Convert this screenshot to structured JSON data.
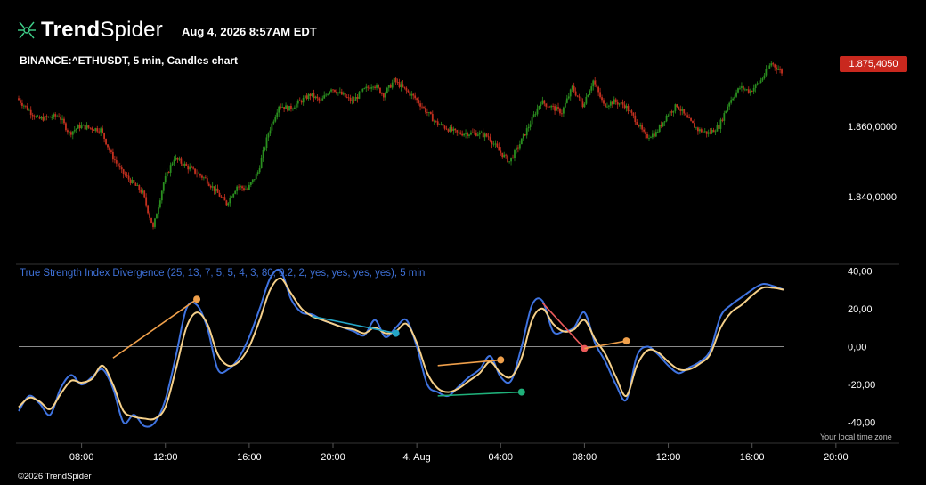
{
  "header": {
    "brand_bold": "Trend",
    "brand_light": "Spider",
    "timestamp": "Aug 4, 2026 8:57AM EDT",
    "symbol_line": "BINANCE:^ETHUSDT, 5 min, Candles chart",
    "current_price": "1.875,4050"
  },
  "indicator": {
    "label": "True Strength Index Divergence (25, 13, 7, 5, 5, 4, 3, 80, 0.2, 2, yes, yes, yes, yes), 5 min"
  },
  "footer": {
    "timezone_note": "Your local time zone",
    "copyright": "©2026 TrendSpider"
  },
  "colors": {
    "up": "#2a8f1f",
    "down": "#c4301f",
    "tsi": "#3f73e0",
    "signal": "#f5d08a",
    "bull_div": "#1fb07a",
    "bear_div": "#f0a04b",
    "hidden_bear": "#ec5b5b",
    "hidden_bull": "#23a6c7",
    "badge": "#c9281e"
  },
  "chart_data": [
    {
      "type": "line",
      "title": "BINANCE:^ETHUSDT, 5 min, Candles chart",
      "style": "candles",
      "y_ticks": [
        {
          "value": 1860,
          "label": "1.860,0000"
        },
        {
          "value": 1840,
          "label": "1.840,0000"
        }
      ],
      "ylim": [
        1822,
        1882
      ],
      "x_ticks": [
        "08:00",
        "12:00",
        "16:00",
        "20:00",
        "4. Aug",
        "04:00",
        "08:00",
        "12:00",
        "16:00",
        "20:00"
      ],
      "xlim_hours": [
        5.0,
        25.0
      ],
      "series": [
        {
          "x_hours": [
            5.0,
            6.0,
            7.0,
            7.5,
            8.0,
            9.0,
            9.5,
            10.0,
            11.0,
            11.5,
            12.0,
            12.5,
            13.0,
            14.0,
            15.0,
            15.5,
            16.0,
            16.5,
            17.0,
            17.5,
            18.0,
            19.0,
            19.5,
            20.0,
            21.0,
            21.5,
            22.0,
            22.5,
            23.0,
            24.0,
            25.0,
            26.0,
            27.0,
            27.5,
            28.0,
            28.5,
            29.0,
            30.0,
            31.0,
            31.5,
            32.0,
            32.5,
            33.0,
            33.5,
            34.0,
            34.5,
            35.0,
            35.5,
            36.0,
            36.5,
            37.0,
            37.5,
            38.0,
            38.5,
            39.0,
            39.5,
            40.0,
            40.5,
            41.0,
            41.5
          ],
          "values": [
            1868,
            1862,
            1863,
            1858,
            1860,
            1859,
            1852,
            1847,
            1841,
            1831,
            1844,
            1851,
            1849,
            1845,
            1838,
            1843,
            1842,
            1847,
            1858,
            1866,
            1865,
            1869,
            1867,
            1871,
            1867,
            1870,
            1872,
            1869,
            1873,
            1868,
            1861,
            1858,
            1858,
            1857,
            1853,
            1850,
            1855,
            1867,
            1864,
            1871,
            1866,
            1873,
            1866,
            1867,
            1866,
            1862,
            1857,
            1858,
            1863,
            1866,
            1862,
            1859,
            1858,
            1860,
            1867,
            1871,
            1870,
            1873,
            1878,
            1875.4
          ]
        }
      ]
    },
    {
      "type": "line",
      "title": "True Strength Index Divergence (25, 13, 7, 5, 5, 4, 3, 80, 0.2, 2, yes, yes, yes, yes), 5 min",
      "y_ticks": [
        {
          "value": 40,
          "label": "40,00"
        },
        {
          "value": 20,
          "label": "20,00"
        },
        {
          "value": 0,
          "label": "0,00"
        },
        {
          "value": -20,
          "label": "-20,00"
        },
        {
          "value": -40,
          "label": "-40,00"
        }
      ],
      "ylim": [
        -50,
        42
      ],
      "series": [
        {
          "x_hours": [
            5.0,
            5.5,
            6.0,
            6.5,
            7.0,
            7.5,
            8.0,
            8.5,
            9.0,
            9.5,
            10.0,
            10.5,
            11.0,
            11.5,
            12.0,
            12.5,
            13.0,
            13.5,
            14.0,
            14.5,
            15.0,
            15.5,
            16.0,
            16.5,
            17.0,
            17.5,
            18.0,
            18.5,
            19.0,
            19.5,
            20.0,
            20.5,
            21.0,
            21.5,
            22.0,
            22.5,
            23.0,
            23.5,
            24.0,
            24.5,
            25.0,
            25.5,
            26.0,
            26.5,
            27.0,
            27.5,
            28.0,
            28.5,
            29.0,
            29.5,
            30.0,
            30.5,
            31.0,
            31.5,
            32.0,
            32.5,
            33.0,
            33.5,
            34.0,
            34.5,
            35.0,
            35.5,
            36.0,
            36.5,
            37.0,
            37.5,
            38.0,
            38.5,
            39.0,
            39.5,
            40.0,
            40.5,
            41.0,
            41.5
          ],
          "values": [
            -34,
            -26,
            -30,
            -36,
            -22,
            -15,
            -20,
            -16,
            -12,
            -22,
            -40,
            -36,
            -42,
            -40,
            -28,
            -5,
            20,
            22,
            10,
            -12,
            -12,
            -6,
            5,
            20,
            36,
            40,
            25,
            18,
            17,
            14,
            12,
            10,
            8,
            6,
            14,
            5,
            10,
            14,
            0,
            -20,
            -24,
            -26,
            -21,
            -16,
            -12,
            -5,
            -16,
            -18,
            0,
            22,
            24,
            8,
            8,
            10,
            18,
            2,
            -8,
            -20,
            -28,
            -5,
            0,
            -4,
            -10,
            -14,
            -11,
            -8,
            -2,
            16,
            22,
            26,
            30,
            33,
            32,
            30
          ]
        },
        {
          "x_hours": [
            5.0,
            5.5,
            6.0,
            6.5,
            7.0,
            7.5,
            8.0,
            8.5,
            9.0,
            9.5,
            10.0,
            10.5,
            11.0,
            11.5,
            12.0,
            12.5,
            13.0,
            13.5,
            14.0,
            14.5,
            15.0,
            15.5,
            16.0,
            16.5,
            17.0,
            17.5,
            18.0,
            18.5,
            19.0,
            19.5,
            20.0,
            20.5,
            21.0,
            21.5,
            22.0,
            22.5,
            23.0,
            23.5,
            24.0,
            24.5,
            25.0,
            25.5,
            26.0,
            26.5,
            27.0,
            27.5,
            28.0,
            28.5,
            29.0,
            29.5,
            30.0,
            30.5,
            31.0,
            31.5,
            32.0,
            32.5,
            33.0,
            33.5,
            34.0,
            34.5,
            35.0,
            35.5,
            36.0,
            36.5,
            37.0,
            37.5,
            38.0,
            38.5,
            39.0,
            39.5,
            40.0,
            40.5,
            41.0,
            41.5
          ],
          "values": [
            -32,
            -27,
            -29,
            -33,
            -25,
            -18,
            -19,
            -17,
            -10,
            -20,
            -34,
            -37,
            -38,
            -38,
            -32,
            -12,
            10,
            18,
            12,
            -4,
            -10,
            -8,
            0,
            14,
            30,
            36,
            28,
            20,
            16,
            14,
            12,
            10,
            9,
            7,
            10,
            7,
            8,
            12,
            2,
            -14,
            -22,
            -24,
            -22,
            -18,
            -14,
            -8,
            -14,
            -16,
            -6,
            14,
            20,
            12,
            8,
            9,
            14,
            4,
            -4,
            -16,
            -26,
            -10,
            -2,
            -3,
            -8,
            -12,
            -12,
            -9,
            -4,
            10,
            18,
            22,
            27,
            31,
            31,
            30
          ]
        }
      ],
      "divergences": [
        {
          "kind": "bear",
          "x_hours": [
            9.5,
            13.5
          ],
          "values": [
            -6,
            25
          ]
        },
        {
          "kind": "hidden-bull",
          "x_hours": [
            19.0,
            23.0
          ],
          "values": [
            16,
            7
          ]
        },
        {
          "kind": "bull",
          "x_hours": [
            25.0,
            29.0
          ],
          "values": [
            -26,
            -24
          ]
        },
        {
          "kind": "bear",
          "x_hours": [
            25.0,
            28.0
          ],
          "values": [
            -10,
            -7
          ]
        },
        {
          "kind": "hidden-bear",
          "x_hours": [
            30.0,
            32.0
          ],
          "values": [
            23,
            -1
          ]
        },
        {
          "kind": "bear",
          "x_hours": [
            32.0,
            34.0
          ],
          "values": [
            -1,
            3
          ]
        }
      ]
    }
  ]
}
